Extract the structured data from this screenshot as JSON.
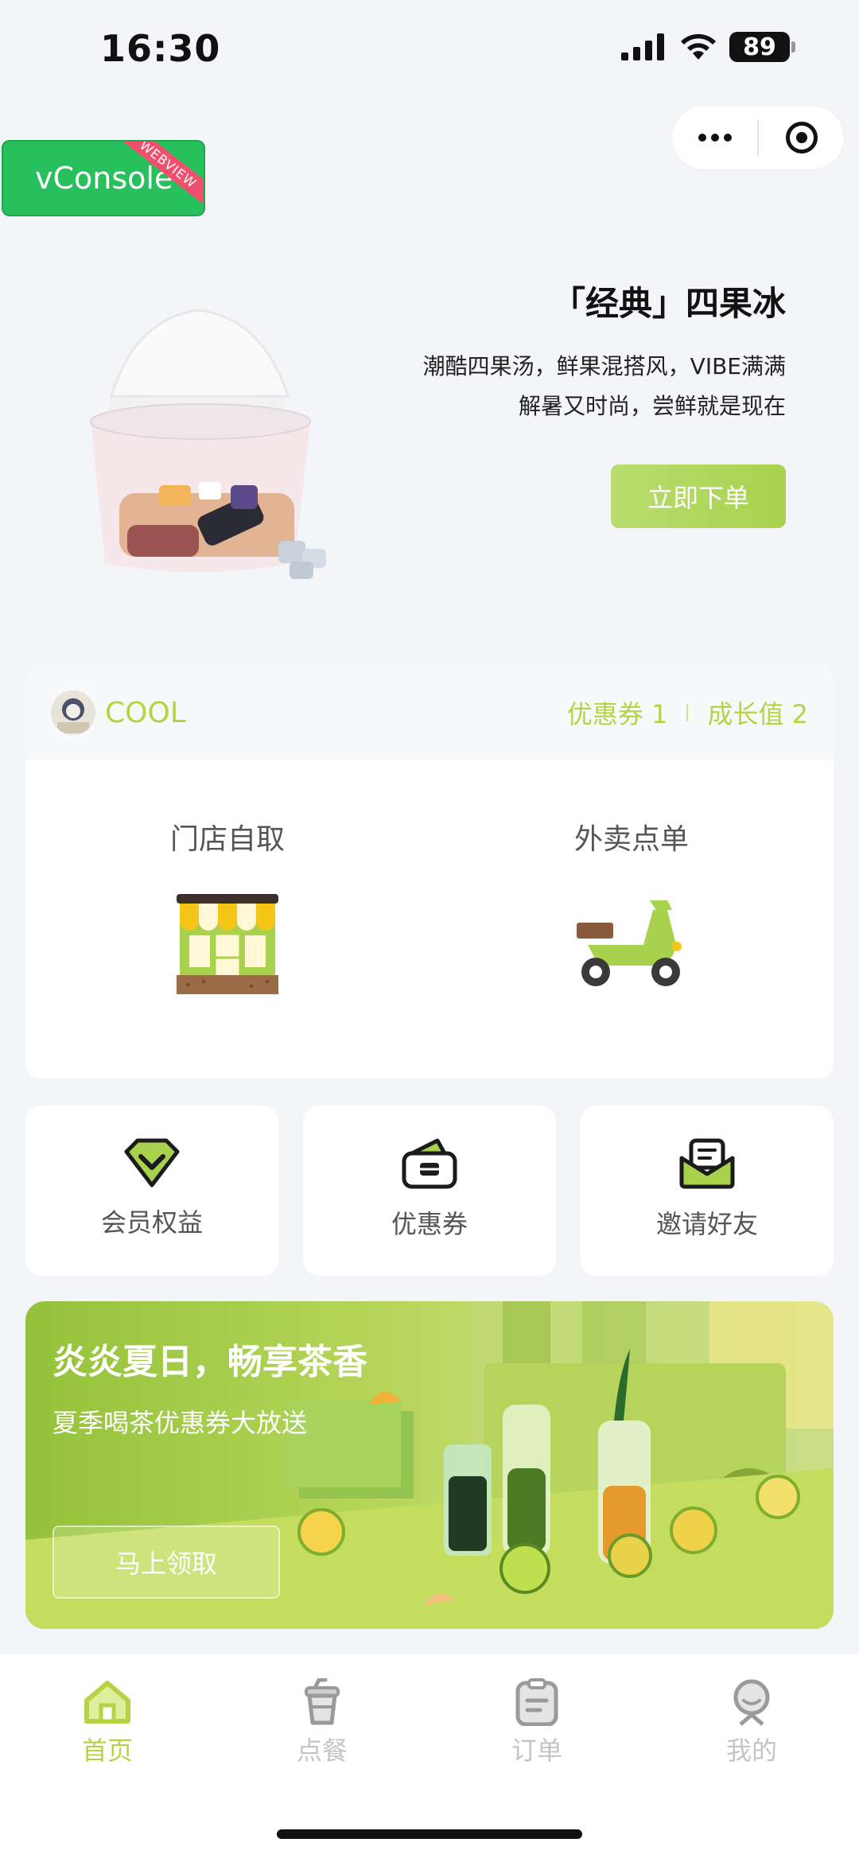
{
  "status_bar": {
    "time": "16:30",
    "battery": "89"
  },
  "capsule": {
    "more_icon": "more-dots-icon",
    "close_icon": "target-icon"
  },
  "vconsole": {
    "label": "vConsole",
    "ribbon": "WEBVIEW"
  },
  "hero": {
    "title": "「经典」四果冰",
    "desc_line1": "潮酷四果汤，鲜果混搭风，VIBE满满",
    "desc_line2": "解暑又时尚，尝鲜就是现在",
    "button": "立即下单"
  },
  "member": {
    "name": "COOL",
    "coupons": "优惠券 1",
    "growth": "成长值 2"
  },
  "order_modes": [
    {
      "label": "门店自取",
      "icon": "store-icon"
    },
    {
      "label": "外卖点单",
      "icon": "scooter-icon"
    }
  ],
  "tiles": [
    {
      "label": "会员权益",
      "icon": "diamond-icon"
    },
    {
      "label": "优惠券",
      "icon": "coupon-wallet-icon"
    },
    {
      "label": "邀请好友",
      "icon": "envelope-icon"
    }
  ],
  "promo": {
    "title": "炎炎夏日，畅享茶香",
    "subtitle": "夏季喝茶优惠券大放送",
    "button": "马上领取"
  },
  "tabbar": [
    {
      "label": "首页",
      "icon": "home-icon",
      "active": true
    },
    {
      "label": "点餐",
      "icon": "cup-icon",
      "active": false
    },
    {
      "label": "订单",
      "icon": "clipboard-icon",
      "active": false
    },
    {
      "label": "我的",
      "icon": "profile-icon",
      "active": false
    }
  ],
  "colors": {
    "accent": "#b5d445",
    "button_green": "#a8d24e",
    "vconsole": "#27c05d"
  }
}
